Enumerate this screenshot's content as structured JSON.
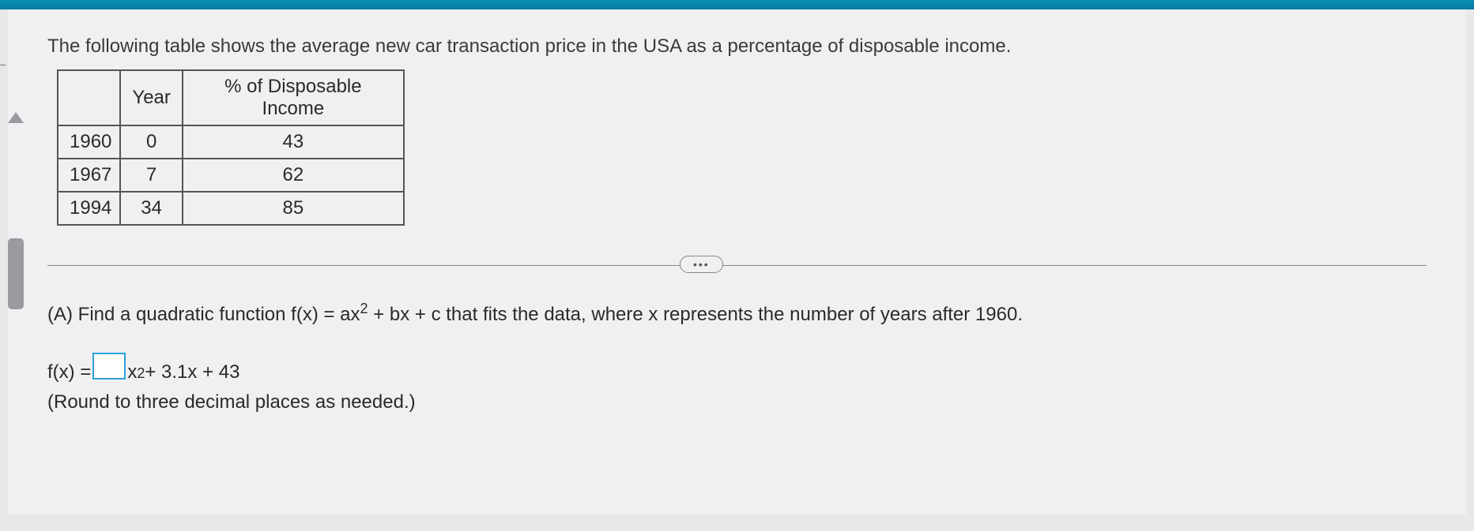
{
  "intro": "The following table shows the average new car transaction price in the USA as a percentage of disposable income.",
  "table": {
    "headers": {
      "blank": "",
      "year": "Year",
      "income": "% of Disposable Income"
    },
    "rows": [
      {
        "label": "1960",
        "year": "0",
        "income": "43"
      },
      {
        "label": "1967",
        "year": "7",
        "income": "62"
      },
      {
        "label": "1994",
        "year": "34",
        "income": "85"
      }
    ]
  },
  "ellipsis": "•••",
  "question": {
    "part_label": "(A) Find a quadratic function f(x) = ax",
    "exp1": "2",
    "tail": " + bx + c that fits the data, where x represents the number of years after 1960."
  },
  "equation": {
    "lhs": "f(x) = ",
    "after_box_x": "x",
    "exp2": "2",
    "rest": " + 3.1x + 43"
  },
  "round_note": "(Round to three decimal places as needed.)",
  "chart_data": {
    "type": "table",
    "title": "Average new car transaction price in the USA as a percentage of disposable income",
    "columns": [
      "Year (calendar)",
      "Year (x, years after 1960)",
      "% of Disposable Income"
    ],
    "rows": [
      [
        "1960",
        0,
        43
      ],
      [
        "1967",
        7,
        62
      ],
      [
        "1994",
        34,
        85
      ]
    ]
  }
}
